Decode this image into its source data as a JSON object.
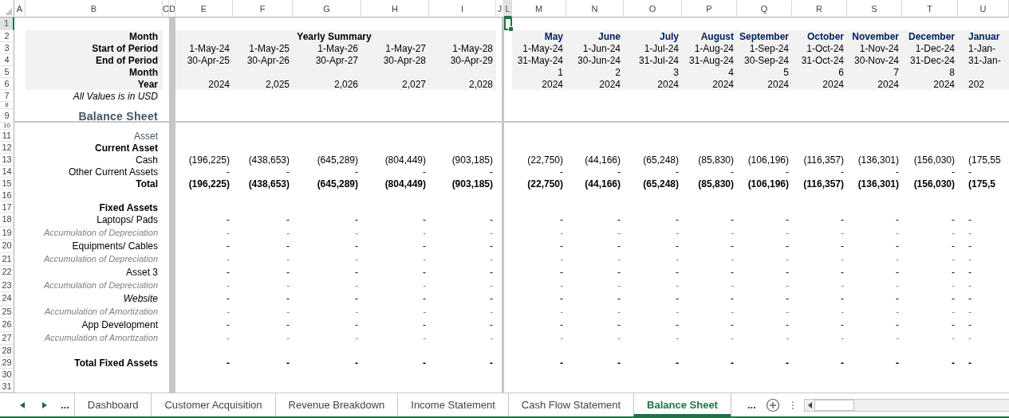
{
  "column_headers": [
    {
      "label": "A",
      "selected": false
    },
    {
      "label": "B",
      "selected": false
    },
    {
      "label": "C",
      "selected": false
    },
    {
      "label": "D",
      "selected": false
    },
    {
      "label": "E",
      "selected": false
    },
    {
      "label": "F",
      "selected": false
    },
    {
      "label": "G",
      "selected": false
    },
    {
      "label": "H",
      "selected": false
    },
    {
      "label": "I",
      "selected": false
    },
    {
      "label": "J",
      "selected": false
    },
    {
      "label": "L",
      "selected": true
    },
    {
      "label": "M",
      "selected": false
    },
    {
      "label": "N",
      "selected": false
    },
    {
      "label": "O",
      "selected": false
    },
    {
      "label": "P",
      "selected": false
    },
    {
      "label": "Q",
      "selected": false
    },
    {
      "label": "R",
      "selected": false
    },
    {
      "label": "S",
      "selected": false
    },
    {
      "label": "T",
      "selected": false
    },
    {
      "label": "U",
      "selected": false
    }
  ],
  "rows": [
    {
      "number": "1",
      "selected": true,
      "kind": "blank"
    },
    {
      "number": "2",
      "selected": false,
      "kind": "titles",
      "label": "Month",
      "yearly_title": "Yearly Summary",
      "monthly": [
        "May",
        "June",
        "July",
        "August",
        "September",
        "October",
        "November",
        "December",
        "Januar"
      ]
    },
    {
      "number": "3",
      "selected": false,
      "kind": "period",
      "label": "Start of Period",
      "yearly": [
        "1-May-24",
        "1-May-25",
        "1-May-26",
        "1-May-27",
        "1-May-28"
      ],
      "monthly": [
        "1-May-24",
        "1-Jun-24",
        "1-Jul-24",
        "1-Aug-24",
        "1-Sep-24",
        "1-Oct-24",
        "1-Nov-24",
        "1-Dec-24",
        "1-Jan-"
      ]
    },
    {
      "number": "4",
      "selected": false,
      "kind": "period",
      "label": "End of Period",
      "yearly": [
        "30-Apr-25",
        "30-Apr-26",
        "30-Apr-27",
        "30-Apr-28",
        "30-Apr-29"
      ],
      "monthly": [
        "31-May-24",
        "30-Jun-24",
        "31-Jul-24",
        "31-Aug-24",
        "30-Sep-24",
        "31-Oct-24",
        "30-Nov-24",
        "31-Dec-24",
        "31-Jan-"
      ]
    },
    {
      "number": "5",
      "selected": false,
      "kind": "period",
      "label": "Month",
      "monthly": [
        "1",
        "2",
        "3",
        "4",
        "5",
        "6",
        "7",
        "8"
      ]
    },
    {
      "number": "6",
      "selected": false,
      "kind": "period",
      "label": "Year",
      "yearly": [
        "2024",
        "2,025",
        "2,026",
        "2,027",
        "2,028"
      ],
      "monthly": [
        "2024",
        "2024",
        "2024",
        "2024",
        "2024",
        "2024",
        "2024",
        "2024",
        "202"
      ]
    },
    {
      "number": "7",
      "selected": false,
      "kind": "note",
      "label": "All Values is in USD"
    },
    {
      "number": "8",
      "selected": false,
      "kind": "blank"
    },
    {
      "number": "9",
      "selected": false,
      "kind": "section",
      "label": "Balance Sheet"
    },
    {
      "number": "10",
      "selected": false,
      "kind": "blank"
    },
    {
      "number": "11",
      "selected": false,
      "kind": "category",
      "label": "Asset"
    },
    {
      "number": "12",
      "selected": false,
      "kind": "group",
      "label": "Current Asset"
    },
    {
      "number": "13",
      "selected": false,
      "kind": "item",
      "label": "Cash",
      "yearly": [
        "(196,225)",
        "(438,653)",
        "(645,289)",
        "(804,449)",
        "(903,185)"
      ],
      "monthly": [
        "(22,750)",
        "(44,166)",
        "(65,248)",
        "(85,830)",
        "(106,196)",
        "(116,357)",
        "(136,301)",
        "(156,030)",
        "(175,55"
      ]
    },
    {
      "number": "14",
      "selected": false,
      "kind": "item",
      "label": "Other Current Assets",
      "yearly": [
        "-",
        "-",
        "-",
        "-",
        "-"
      ],
      "monthly": [
        "-",
        "-",
        "-",
        "-",
        "-",
        "-",
        "-",
        "-",
        "-"
      ]
    },
    {
      "number": "15",
      "selected": false,
      "kind": "total",
      "label": "Total",
      "yearly": [
        "(196,225)",
        "(438,653)",
        "(645,289)",
        "(804,449)",
        "(903,185)"
      ],
      "monthly": [
        "(22,750)",
        "(44,166)",
        "(65,248)",
        "(85,830)",
        "(106,196)",
        "(116,357)",
        "(136,301)",
        "(156,030)",
        "(175,5"
      ]
    },
    {
      "number": "16",
      "selected": false,
      "kind": "blank"
    },
    {
      "number": "17",
      "selected": false,
      "kind": "group",
      "label": "Fixed Assets"
    },
    {
      "number": "18",
      "selected": false,
      "kind": "item",
      "label": "Laptops/ Pads",
      "yearly": [
        "-",
        "-",
        "-",
        "-",
        "-"
      ],
      "monthly": [
        "-",
        "-",
        "-",
        "-",
        "-",
        "-",
        "-",
        "-",
        "-"
      ]
    },
    {
      "number": "19",
      "selected": false,
      "kind": "subitem",
      "label": "Accumulation of Depreciation",
      "yearly": [
        "-",
        "-",
        "-",
        "-",
        "-"
      ],
      "monthly": [
        "-",
        "-",
        "-",
        "-",
        "-",
        "-",
        "-",
        "-",
        "-"
      ]
    },
    {
      "number": "20",
      "selected": false,
      "kind": "item",
      "label": "Equipments/ Cables",
      "yearly": [
        "-",
        "-",
        "-",
        "-",
        "-"
      ],
      "monthly": [
        "-",
        "-",
        "-",
        "-",
        "-",
        "-",
        "-",
        "-",
        "-"
      ]
    },
    {
      "number": "21",
      "selected": false,
      "kind": "subitem",
      "label": "Accumulation of Depreciation",
      "yearly": [
        "-",
        "-",
        "-",
        "-",
        "-"
      ],
      "monthly": [
        "-",
        "-",
        "-",
        "-",
        "-",
        "-",
        "-",
        "-",
        "-"
      ]
    },
    {
      "number": "22",
      "selected": false,
      "kind": "item",
      "label": "Asset 3",
      "yearly": [
        "-",
        "-",
        "-",
        "-",
        "-"
      ],
      "monthly": [
        "-",
        "-",
        "-",
        "-",
        "-",
        "-",
        "-",
        "-",
        "-"
      ]
    },
    {
      "number": "23",
      "selected": false,
      "kind": "subitem",
      "label": "Accumulation of Depreciation",
      "yearly": [
        "-",
        "-",
        "-",
        "-",
        "-"
      ],
      "monthly": [
        "-",
        "-",
        "-",
        "-",
        "-",
        "-",
        "-",
        "-",
        "-"
      ]
    },
    {
      "number": "24",
      "selected": false,
      "kind": "emphasis",
      "label": "Website",
      "yearly": [
        "-",
        "-",
        "-",
        "-",
        "-"
      ],
      "monthly": [
        "-",
        "-",
        "-",
        "-",
        "-",
        "-",
        "-",
        "-",
        "-"
      ]
    },
    {
      "number": "25",
      "selected": false,
      "kind": "subitem",
      "label": "Accumulation of Amortization",
      "yearly": [
        "-",
        "-",
        "-",
        "-",
        "-"
      ],
      "monthly": [
        "-",
        "-",
        "-",
        "-",
        "-",
        "-",
        "-",
        "-",
        "-"
      ]
    },
    {
      "number": "26",
      "selected": false,
      "kind": "item",
      "label": "App Development",
      "yearly": [
        "-",
        "-",
        "-",
        "-",
        "-"
      ],
      "monthly": [
        "-",
        "-",
        "-",
        "-",
        "-",
        "-",
        "-",
        "-",
        "-"
      ]
    },
    {
      "number": "27",
      "selected": false,
      "kind": "subitem",
      "label": "Accumulation of Amortization",
      "yearly": [
        "-",
        "-",
        "-",
        "-",
        "-"
      ],
      "monthly": [
        "-",
        "-",
        "-",
        "-",
        "-",
        "-",
        "-",
        "-",
        "-"
      ]
    },
    {
      "number": "28",
      "selected": false,
      "kind": "blank"
    },
    {
      "number": "29",
      "selected": false,
      "kind": "total",
      "label": "Total Fixed Assets",
      "yearly": [
        "-",
        "-",
        "-",
        "-",
        "-"
      ],
      "monthly": [
        "-",
        "-",
        "-",
        "-",
        "-",
        "-",
        "-",
        "-",
        "-"
      ]
    },
    {
      "number": "30",
      "selected": false,
      "kind": "blank"
    },
    {
      "number": "31",
      "selected": false,
      "kind": "blank"
    }
  ],
  "sheet_tabs": {
    "overflow_left": "...",
    "overflow_right": "...",
    "tabs": [
      {
        "label": "Dashboard",
        "selected": false
      },
      {
        "label": "Customer Acquisition",
        "selected": false
      },
      {
        "label": "Revenue Breakdown",
        "selected": false
      },
      {
        "label": "Income Statement",
        "selected": false
      },
      {
        "label": "Cash Flow Statement",
        "selected": false
      },
      {
        "label": "Balance Sheet",
        "selected": true
      }
    ]
  }
}
